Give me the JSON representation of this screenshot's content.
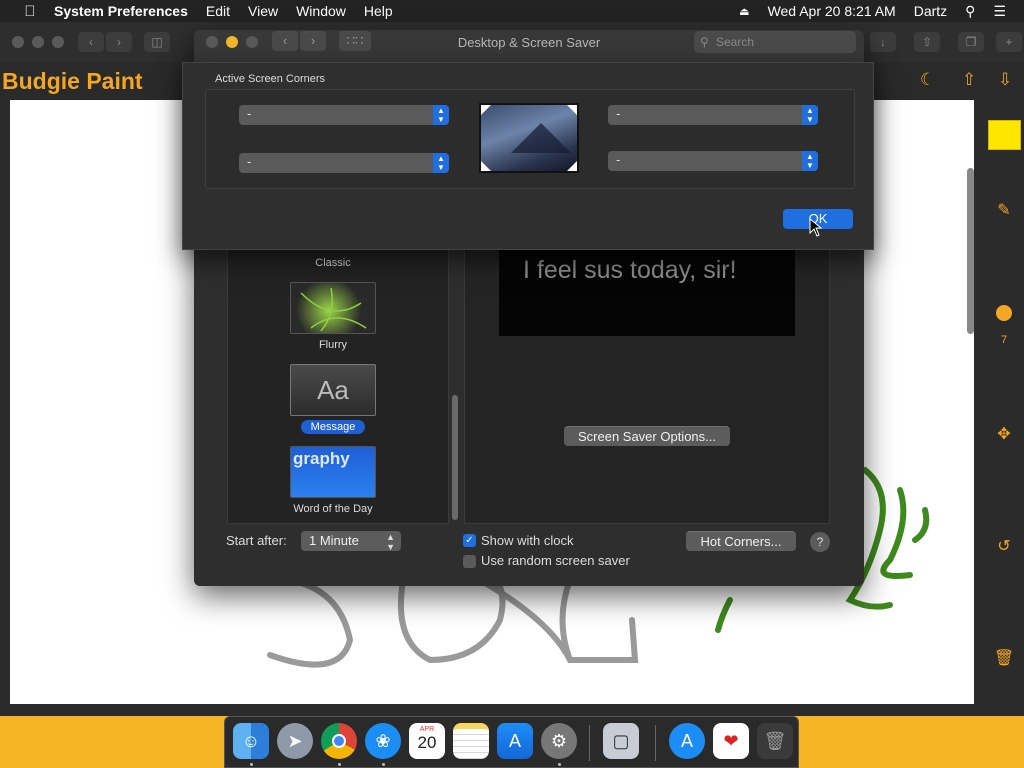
{
  "menubar": {
    "app_name": "System Preferences",
    "menus": [
      "Edit",
      "View",
      "Window",
      "Help"
    ],
    "datetime": "Wed Apr 20  8:21 AM",
    "user": "Dartz"
  },
  "paint": {
    "title": "Budgie Paint",
    "brush_size": "7"
  },
  "sysprefs": {
    "window_title": "Desktop & Screen Saver",
    "search_placeholder": "Search",
    "savers": [
      {
        "label": "Classic"
      },
      {
        "label": "Flurry"
      },
      {
        "label": "Message",
        "icon_text": "Aa"
      },
      {
        "label": "Word of the Day",
        "icon_text": "graphy"
      }
    ],
    "preview_text": "I feel sus today, sir!",
    "options_button": "Screen Saver Options...",
    "start_after_label": "Start after:",
    "start_after_value": "1 Minute",
    "show_with_clock": "Show with clock",
    "use_random": "Use random screen saver",
    "hot_corners_button": "Hot Corners...",
    "help": "?"
  },
  "hot_corners_sheet": {
    "title": "Active Screen Corners",
    "top_left": "-",
    "bottom_left": "-",
    "top_right": "-",
    "bottom_right": "-",
    "ok": "OK"
  },
  "dock": {
    "calendar_month": "APR",
    "calendar_day": "20"
  },
  "colors": {
    "accent": "#f5a623",
    "select_blue": "#1f6fe0",
    "stroke_gray": "#9a9a9a",
    "stroke_green": "#3e8a1e"
  }
}
